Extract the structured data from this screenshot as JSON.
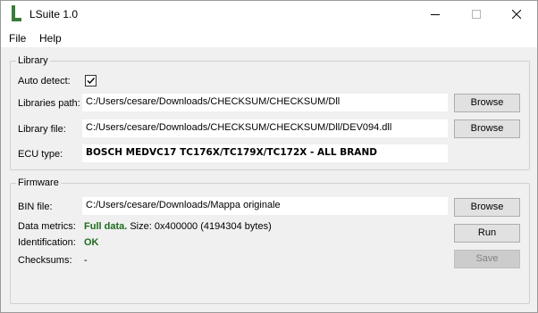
{
  "window": {
    "title": "LSuite 1.0",
    "logo_letter": "L"
  },
  "menu": {
    "file": "File",
    "help": "Help"
  },
  "library": {
    "group_title": "Library",
    "auto_detect_label": "Auto detect:",
    "auto_detect_checked": true,
    "libraries_path_label": "Libraries path:",
    "libraries_path_value": "C:/Users/cesare/Downloads/CHECKSUM/CHECKSUM/Dll",
    "library_file_label": "Library file:",
    "library_file_value": "C:/Users/cesare/Downloads/CHECKSUM/CHECKSUM/Dll/DEV094.dll",
    "ecu_type_label": "ECU type:",
    "ecu_type_value": "BOSCH MEDVC17 TC176X/TC179X/TC172X - ALL BRAND",
    "browse_label": "Browse"
  },
  "firmware": {
    "group_title": "Firmware",
    "bin_file_label": "BIN file:",
    "bin_file_value": "C:/Users/cesare/Downloads/Mappa originale",
    "data_metrics_label": "Data metrics:",
    "data_metrics_status": "Full data.",
    "data_metrics_detail": "Size: 0x400000 (4194304 bytes)",
    "identification_label": "Identification:",
    "identification_value": "OK",
    "checksums_label": "Checksums:",
    "checksums_value": "-",
    "browse_label": "Browse",
    "run_label": "Run",
    "save_label": "Save"
  },
  "colors": {
    "logo_green": "#3a7d3a",
    "ok_green": "#1e6b1e"
  }
}
